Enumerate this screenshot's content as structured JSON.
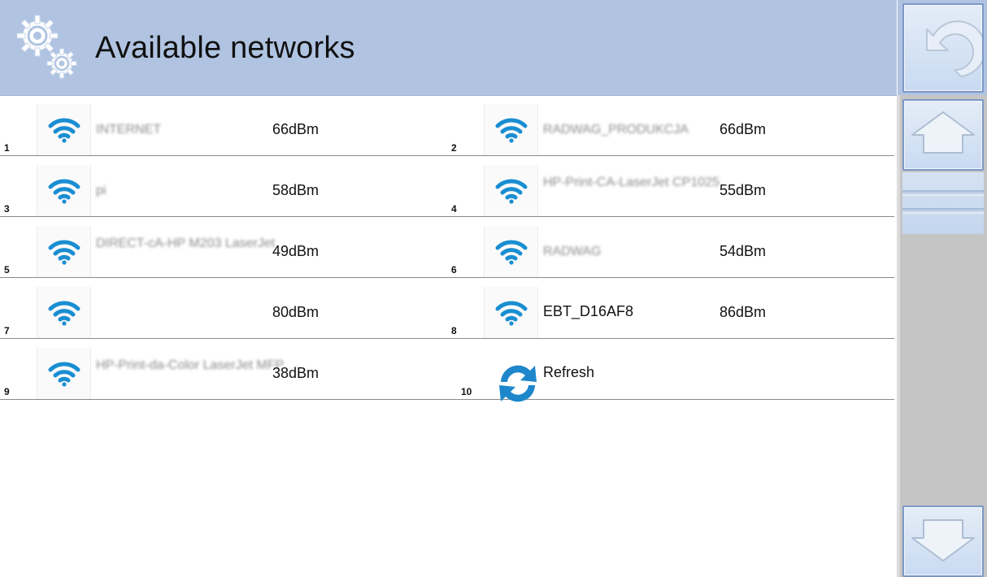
{
  "header": {
    "title": "Available networks",
    "icon": "settings-gears-icon"
  },
  "nav": {
    "back_icon": "undo-arrow-icon",
    "up_icon": "arrow-up-icon",
    "down_icon": "arrow-down-icon"
  },
  "colors": {
    "header_bg": "#b0c4e2",
    "wifi_blue": "#1a8ed2"
  },
  "networks": [
    {
      "index": "1",
      "name": "INTERNET",
      "signal": "66dBm",
      "icon": "wifi-icon",
      "obscured": true
    },
    {
      "index": "2",
      "name": "RADWAG_PRODUKCJA",
      "signal": "66dBm",
      "icon": "wifi-icon",
      "obscured": true
    },
    {
      "index": "3",
      "name": "pi",
      "signal": "58dBm",
      "icon": "wifi-icon",
      "obscured": true
    },
    {
      "index": "4",
      "name": "HP-Print-CA-LaserJet CP1025",
      "signal": "55dBm",
      "icon": "wifi-icon",
      "obscured": true
    },
    {
      "index": "5",
      "name": "DIRECT-cA-HP M203 LaserJet",
      "signal": "49dBm",
      "icon": "wifi-icon",
      "obscured": true
    },
    {
      "index": "6",
      "name": "RADWAG",
      "signal": "54dBm",
      "icon": "wifi-icon",
      "obscured": true
    },
    {
      "index": "7",
      "name": "",
      "signal": "80dBm",
      "icon": "wifi-icon",
      "obscured": false
    },
    {
      "index": "8",
      "name": "EBT_D16AF8",
      "signal": "86dBm",
      "icon": "wifi-icon",
      "obscured": false
    },
    {
      "index": "9",
      "name": "HP-Print-da-Color LaserJet MFP",
      "signal": "38dBm",
      "icon": "wifi-icon",
      "obscured": true
    }
  ],
  "refresh": {
    "index": "10",
    "label": "Refresh",
    "icon": "refresh-icon"
  }
}
